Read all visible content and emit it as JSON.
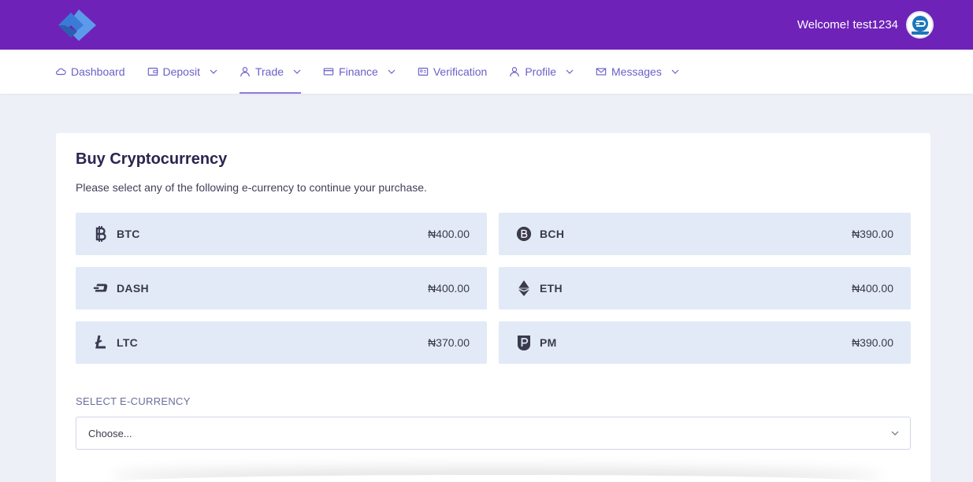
{
  "header": {
    "welcome": "Welcome! test1234",
    "brand_color": "#6e22b8"
  },
  "nav": {
    "items": [
      {
        "label": "Dashboard",
        "icon": "cloud-icon"
      },
      {
        "label": "Deposit",
        "icon": "wallet-icon"
      },
      {
        "label": "Trade",
        "icon": "user-icon"
      },
      {
        "label": "Finance",
        "icon": "card-icon"
      },
      {
        "label": "Verification",
        "icon": "id-card-icon"
      },
      {
        "label": "Profile",
        "icon": "user-icon"
      },
      {
        "label": "Messages",
        "icon": "envelope-icon"
      }
    ],
    "active": "Trade"
  },
  "page": {
    "title": "Buy Cryptocurrency",
    "subtitle": "Please select any of the following e-currency to continue your purchase."
  },
  "coins": [
    {
      "name": "BTC",
      "price": "₦400.00",
      "icon": "bitcoin-icon"
    },
    {
      "name": "BCH",
      "price": "₦390.00",
      "icon": "bitcoin-cash-icon"
    },
    {
      "name": "DASH",
      "price": "₦400.00",
      "icon": "dash-icon"
    },
    {
      "name": "ETH",
      "price": "₦400.00",
      "icon": "ethereum-icon"
    },
    {
      "name": "LTC",
      "price": "₦370.00",
      "icon": "litecoin-icon"
    },
    {
      "name": "PM",
      "price": "₦390.00",
      "icon": "perfect-money-icon"
    }
  ],
  "select": {
    "label": "SELECT E-CURRENCY",
    "value": "Choose..."
  }
}
